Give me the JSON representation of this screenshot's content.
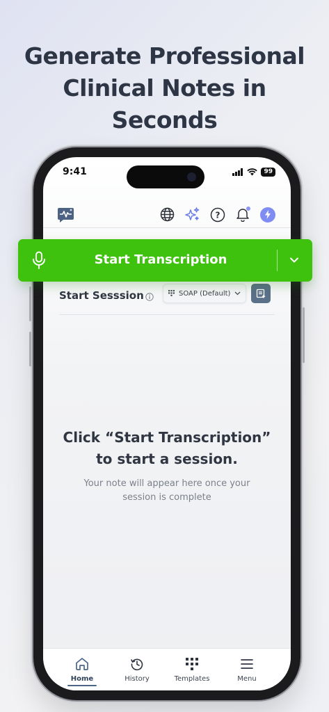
{
  "headline": [
    "Generate Professional",
    "Clinical Notes in",
    "Seconds"
  ],
  "status_bar": {
    "time": "9:41",
    "battery": "99"
  },
  "header_icons": [
    "waveform-chat-logo-icon",
    "globe-icon",
    "sparkles-icon",
    "help-icon",
    "bell-icon",
    "bolt-icon"
  ],
  "start_button": {
    "label": "Start Transcription"
  },
  "session": {
    "title": "Start Sesssion",
    "template": "SOAP (Default)"
  },
  "empty_state": {
    "title_line1": "Click “Start Transcription”",
    "title_line2": "to start a session.",
    "subtitle_line1": "Your note will appear here once your",
    "subtitle_line2": "session is complete"
  },
  "tabs": [
    {
      "label": "Home",
      "icon": "home-icon",
      "active": true
    },
    {
      "label": "History",
      "icon": "history-icon",
      "active": false
    },
    {
      "label": "Templates",
      "icon": "templates-grid-icon",
      "active": false
    },
    {
      "label": "Menu",
      "icon": "menu-icon",
      "active": false
    }
  ],
  "colors": {
    "accent_green": "#3ec20d",
    "accent_slate": "#4b6587",
    "accent_purple": "#7f8cf1"
  }
}
